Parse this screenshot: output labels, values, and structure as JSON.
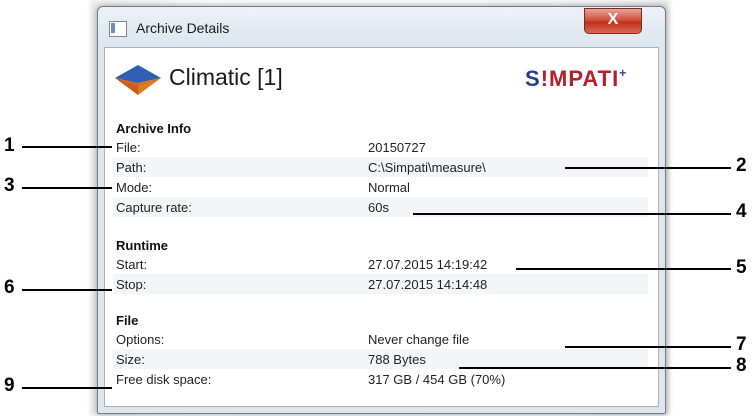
{
  "window": {
    "title": "Archive Details",
    "close_label": "X"
  },
  "header": {
    "title": "Climatic [1]",
    "brand": {
      "s": "S",
      "i": "!",
      "rest": "MPATI",
      "mark": "+"
    }
  },
  "sections": {
    "archive": {
      "heading": "Archive Info",
      "rows": [
        {
          "label": "File:",
          "value": "20150727"
        },
        {
          "label": "Path:",
          "value": "C:\\Simpati\\measure\\"
        },
        {
          "label": "Mode:",
          "value": "Normal"
        },
        {
          "label": "Capture rate:",
          "value": "60s"
        }
      ]
    },
    "runtime": {
      "heading": "Runtime",
      "rows": [
        {
          "label": "Start:",
          "value": "27.07.2015 14:19:42"
        },
        {
          "label": "Stop:",
          "value": "27.07.2015 14:14:48"
        }
      ]
    },
    "file": {
      "heading": "File",
      "rows": [
        {
          "label": "Options:",
          "value": "Never change file"
        },
        {
          "label": "Size:",
          "value": "788 Bytes"
        },
        {
          "label": "Free disk space:",
          "value": "317 GB / 454 GB (70%)"
        }
      ]
    }
  },
  "callouts": [
    "1",
    "2",
    "3",
    "4",
    "5",
    "6",
    "7",
    "8",
    "9"
  ],
  "colors": {
    "brand_blue": "#2f3b8f",
    "brand_red": "#b3202c",
    "close_red": "#c1311b"
  }
}
